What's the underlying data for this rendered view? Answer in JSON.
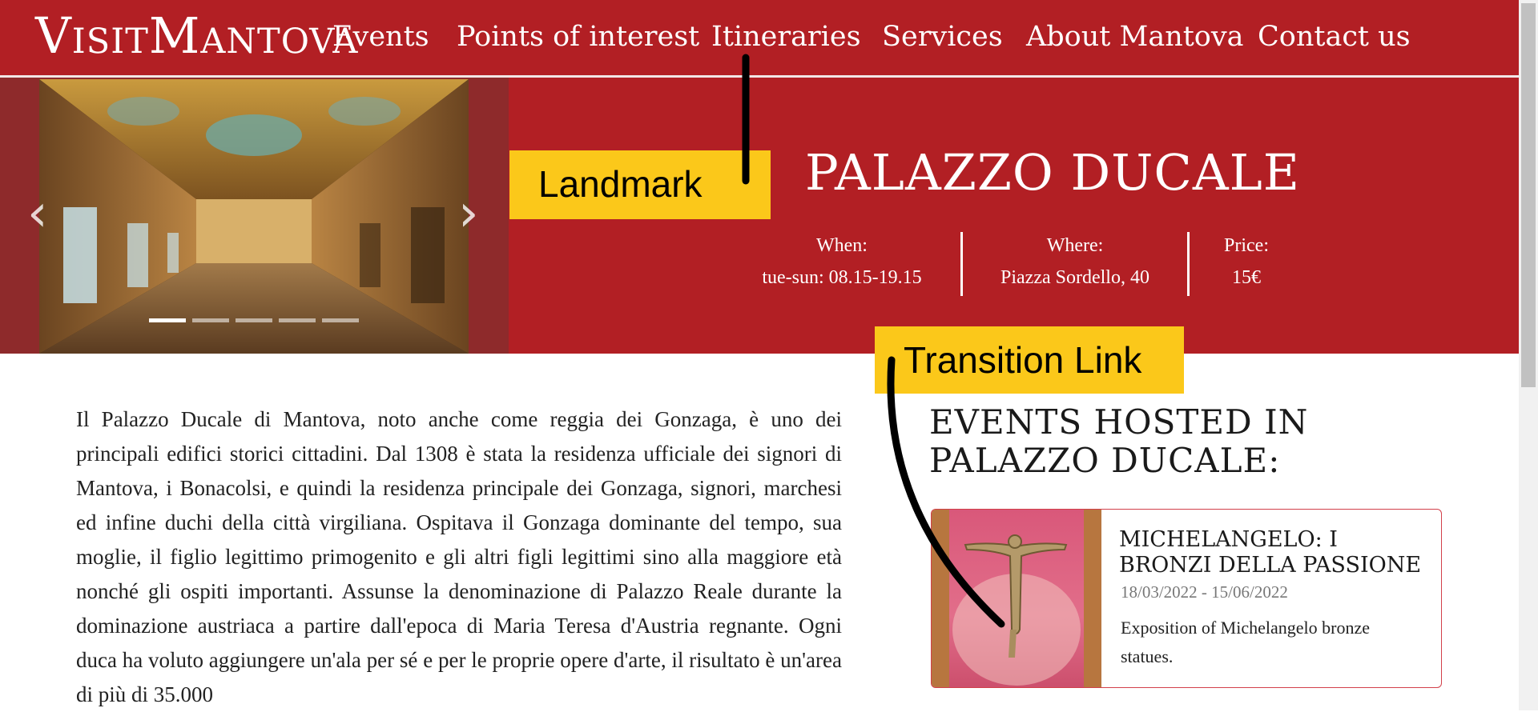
{
  "nav": {
    "logo": "VisitMantova",
    "items": [
      "Events",
      "Points of interest",
      "Itineraries",
      "Services",
      "About Mantova",
      "Contact us"
    ]
  },
  "hero": {
    "title": "PALAZZO DUCALE",
    "carousel": {
      "slide_count": 5,
      "active_index": 0
    },
    "info": [
      {
        "label": "When:",
        "value": "tue-sun: 08.15-19.15"
      },
      {
        "label": "Where:",
        "value": "Piazza Sordello, 40"
      },
      {
        "label": "Price:",
        "value": "15€"
      }
    ]
  },
  "annotations": {
    "landmark": "Landmark",
    "transition_link": "Transition Link"
  },
  "content": {
    "description": "Il Palazzo Ducale di Mantova, noto anche come reggia dei Gonzaga, è uno dei principali edifici storici cittadini. Dal 1308 è stata la residenza ufficiale dei signori di Mantova, i Bonacolsi, e quindi la residenza principale dei Gonzaga, signori, marchesi ed infine duchi della città virgiliana. Ospitava il Gonzaga dominante del tempo, sua moglie, il figlio legittimo primogenito e gli altri figli legittimi sino alla maggiore età nonché gli ospiti importanti. Assunse la denominazione di Palazzo Reale durante la dominazione austriaca a partire dall'epoca di Maria Teresa d'Austria regnante. Ogni duca ha voluto aggiungere un'ala per sé e per le proprie opere d'arte, il risultato è un'area di più di 35.000"
  },
  "events": {
    "heading": "EVENTS HOSTED IN PALAZZO DUCALE:",
    "cards": [
      {
        "title": "MICHELANGELO: I BRONZI DELLA PASSIONE",
        "date": "18/03/2022 - 15/06/2022",
        "description": "Exposition of Michelangelo bronze statues."
      }
    ]
  },
  "colors": {
    "brand_red": "#b21f24",
    "annotation_yellow": "#fbc81a",
    "card_border": "#d2404a"
  }
}
